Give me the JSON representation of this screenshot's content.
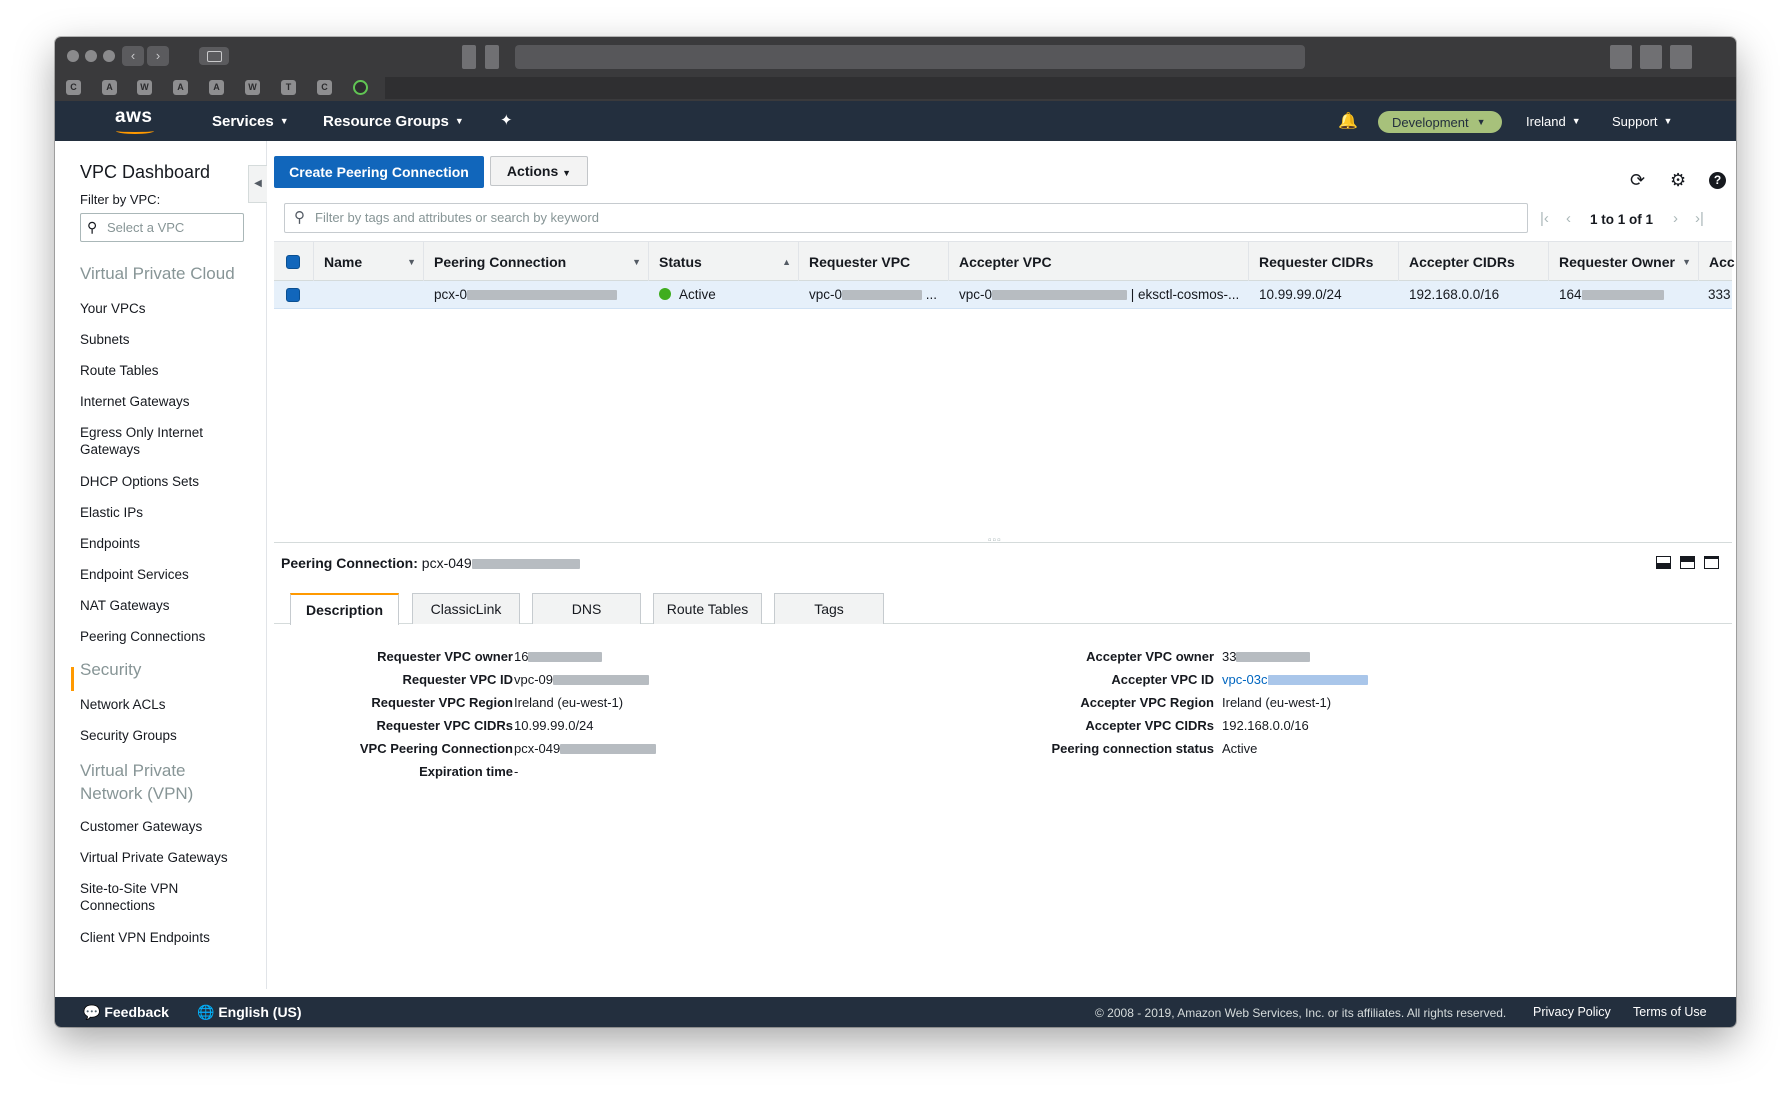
{
  "aws": {
    "logo": "aws",
    "services": "Services",
    "resource_groups": "Resource Groups",
    "environment": "Development",
    "region": "Ireland",
    "support": "Support"
  },
  "leftnav": {
    "title": "VPC Dashboard",
    "filter_label": "Filter by VPC:",
    "filter_placeholder": "Select a VPC",
    "section_vpc": "Virtual Private Cloud",
    "items_vpc": [
      "Your VPCs",
      "Subnets",
      "Route Tables",
      "Internet Gateways",
      "Egress Only Internet Gateways",
      "DHCP Options Sets",
      "Elastic IPs",
      "Endpoints",
      "Endpoint Services",
      "NAT Gateways",
      "Peering Connections"
    ],
    "section_security": "Security",
    "items_security": [
      "Network ACLs",
      "Security Groups"
    ],
    "section_vpn": "Virtual Private Network (VPN)",
    "items_vpn": [
      "Customer Gateways",
      "Virtual Private Gateways",
      "Site-to-Site VPN Connections",
      "Client VPN Endpoints"
    ]
  },
  "toolbar": {
    "create_label": "Create Peering Connection",
    "actions_label": "Actions",
    "search_placeholder": "Filter by tags and attributes or search by keyword",
    "pager_text": "1 to 1 of 1"
  },
  "table": {
    "columns": [
      "Name",
      "Peering Connection",
      "Status",
      "Requester VPC",
      "Accepter VPC",
      "Requester CIDRs",
      "Accepter CIDRs",
      "Requester Owner",
      "Acc"
    ],
    "row": {
      "name": "",
      "peering_connection": "pcx-0",
      "status": "Active",
      "requester_vpc": "vpc-0",
      "requester_vpc_suffix": "...",
      "accepter_vpc": "vpc-0",
      "accepter_vpc_suffix": "| eksctl-cosmos-...",
      "requester_cidrs": "10.99.99.0/24",
      "accepter_cidrs": "192.168.0.0/16",
      "requester_owner": "164",
      "acc": "333"
    }
  },
  "detail": {
    "title_label": "Peering Connection:",
    "title_value": "pcx-049",
    "tabs": [
      "Description",
      "ClassicLink",
      "DNS",
      "Route Tables",
      "Tags"
    ],
    "left": [
      {
        "label": "Requester VPC owner",
        "value": "16"
      },
      {
        "label": "Requester VPC ID",
        "value": "vpc-09"
      },
      {
        "label": "Requester VPC Region",
        "value": "Ireland (eu-west-1)"
      },
      {
        "label": "Requester VPC CIDRs",
        "value": "10.99.99.0/24"
      },
      {
        "label": "VPC Peering Connection",
        "value": "pcx-049"
      },
      {
        "label": "Expiration time",
        "value": "-"
      }
    ],
    "right": [
      {
        "label": "Accepter VPC owner",
        "value": "33"
      },
      {
        "label": "Accepter VPC ID",
        "value": "vpc-03c"
      },
      {
        "label": "Accepter VPC Region",
        "value": "Ireland (eu-west-1)"
      },
      {
        "label": "Accepter VPC CIDRs",
        "value": "192.168.0.0/16"
      },
      {
        "label": "Peering connection status",
        "value": "Active"
      }
    ]
  },
  "footer": {
    "feedback": "Feedback",
    "language": "English (US)",
    "copyright": "© 2008 - 2019, Amazon Web Services, Inc. or its affiliates. All rights reserved.",
    "privacy": "Privacy Policy",
    "terms": "Terms of Use"
  },
  "colors": {
    "aws_navy": "#232f3e",
    "primary_blue": "#1166bb",
    "accent_orange": "#ff9900",
    "active_green": "#3fad1e",
    "env_badge": "#a7c17b"
  },
  "icons": [
    "search-icon",
    "refresh-icon",
    "gear-icon",
    "help-icon",
    "bell-icon",
    "pin-icon",
    "feedback-icon",
    "globe-icon"
  ]
}
